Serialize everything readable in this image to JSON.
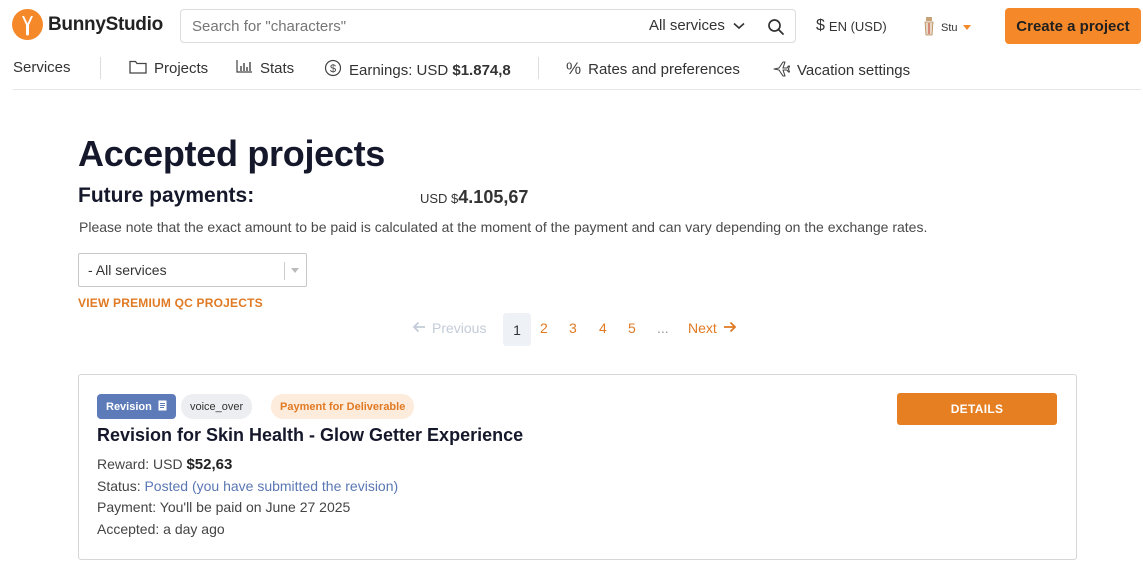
{
  "header": {
    "logo_text": "BunnyStudio",
    "search_placeholder": "Search for \"characters\"",
    "service_filter": "All services",
    "currency": "EN (USD)",
    "user_name": "Stu",
    "create_button": "Create a project"
  },
  "nav": {
    "services": "Services",
    "projects": "Projects",
    "stats": "Stats",
    "earnings_label": "Earnings: USD ",
    "earnings_amount": "$1.874,8",
    "rates": "Rates and preferences",
    "vacation": "Vacation settings"
  },
  "main": {
    "title": "Accepted projects",
    "future_payments_label": "Future payments:",
    "future_payments_currency": "USD $",
    "future_payments_amount": "4.105,67",
    "note": "Please note that the exact amount to be paid is calculated at the moment of the payment and can vary depending on the exchange rates.",
    "filter_value": "- All services",
    "premium_link": "VIEW PREMIUM QC PROJECTS"
  },
  "pagination": {
    "previous": "Previous",
    "pages": [
      "1",
      "2",
      "3",
      "4",
      "5"
    ],
    "current": "1",
    "ellipsis": "...",
    "next": "Next"
  },
  "project": {
    "badge_revision": "Revision",
    "badge_service": "voice_over",
    "badge_payment": "Payment for Deliverable",
    "details_button": "DETAILS",
    "title": "Revision for Skin Health - Glow Getter Experience",
    "reward_label": "Reward: USD ",
    "reward_value": "$52,63",
    "status_label": "Status: ",
    "status_value": "Posted (you have submitted the revision)",
    "payment_text": "Payment: You'll be paid on June 27 2025",
    "accepted_text": "Accepted: a day ago"
  },
  "colors": {
    "brand_orange": "#f5892a",
    "link_orange": "#e07a24",
    "revision_blue": "#5d7bb8"
  }
}
